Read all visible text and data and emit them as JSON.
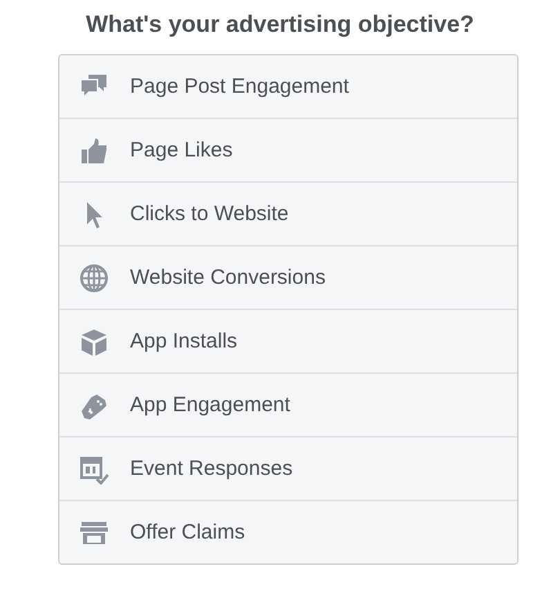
{
  "title": "What's your advertising objective?",
  "objectives": [
    {
      "label": "Page Post Engagement",
      "kind": "comments"
    },
    {
      "label": "Page Likes",
      "kind": "like"
    },
    {
      "label": "Clicks to Website",
      "kind": "cursor"
    },
    {
      "label": "Website Conversions",
      "kind": "globe"
    },
    {
      "label": "App Installs",
      "kind": "cube"
    },
    {
      "label": "App Engagement",
      "kind": "gamepad"
    },
    {
      "label": "Event Responses",
      "kind": "calendar"
    },
    {
      "label": "Offer Claims",
      "kind": "store"
    }
  ]
}
